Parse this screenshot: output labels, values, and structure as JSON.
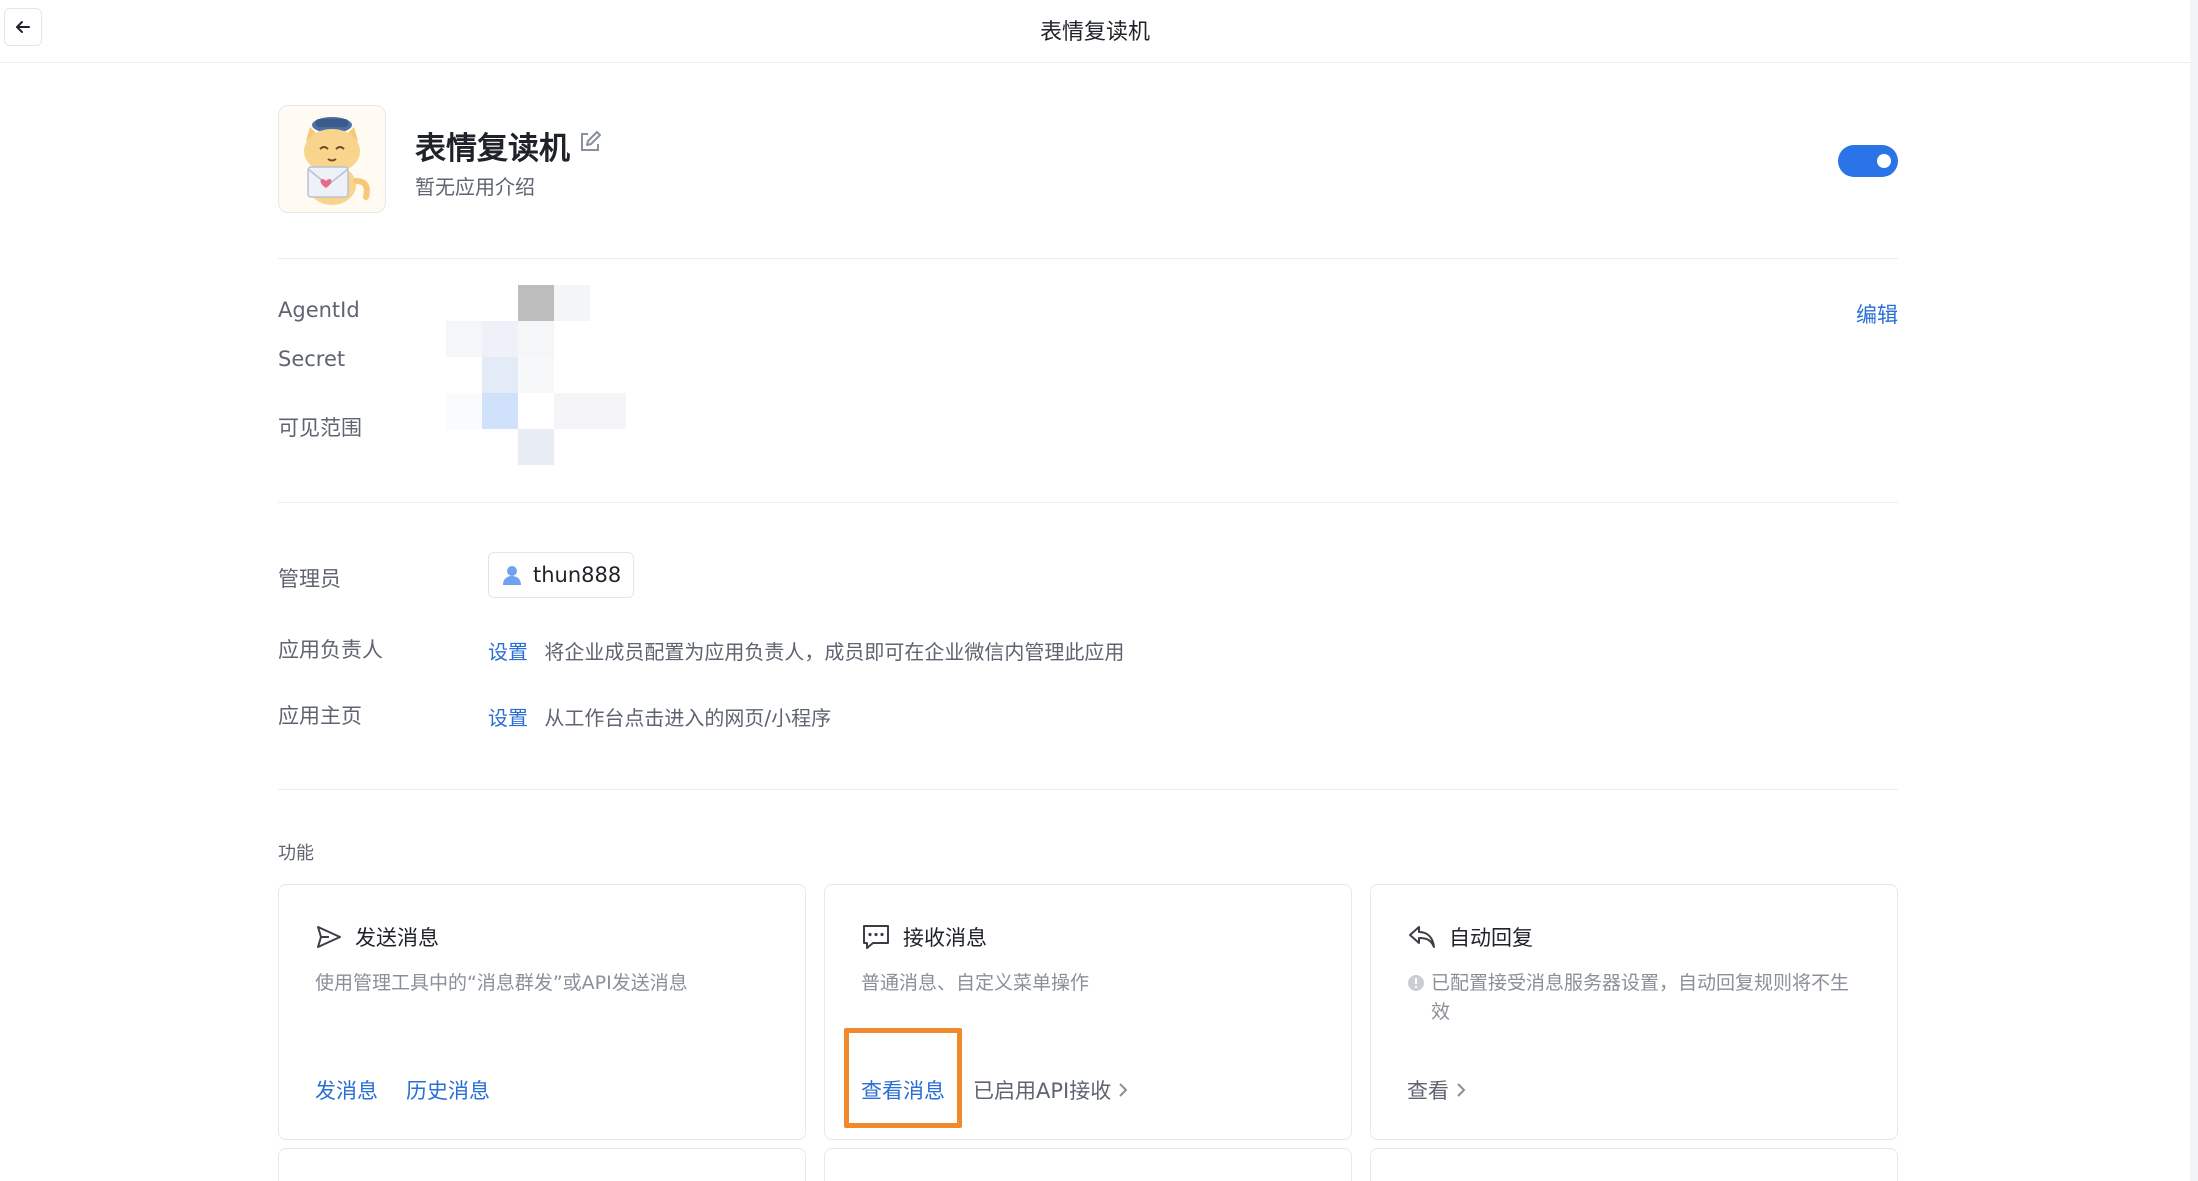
{
  "window": {
    "title": "表情复读机"
  },
  "app": {
    "name": "表情复读机",
    "description": "暂无应用介绍",
    "enabled": true,
    "accent": "#2a74e8"
  },
  "credentials": {
    "agentid_label": "AgentId",
    "secret_label": "Secret",
    "scope_label": "可见范围",
    "edit_label": "编辑"
  },
  "admin": {
    "admin_label": "管理员",
    "admin_user": "thun888",
    "owner_label": "应用负责人",
    "owner_action": "设置",
    "owner_hint": "将企业成员配置为应用负责人，成员即可在企业微信内管理此应用",
    "home_label": "应用主页",
    "home_action": "设置",
    "home_hint": "从工作台点击进入的网页/小程序"
  },
  "features": {
    "title": "功能",
    "cards": [
      {
        "title": "发送消息",
        "icon": "send-icon",
        "desc": "使用管理工具中的“消息群发”或API发送消息",
        "actions": [
          "发消息",
          "历史消息"
        ]
      },
      {
        "title": "接收消息",
        "icon": "chat-icon",
        "desc": "普通消息、自定义菜单操作",
        "actions": [
          "查看消息"
        ],
        "secondary": "已启用API接收"
      },
      {
        "title": "自动回复",
        "icon": "reply-icon",
        "desc": "已配置接受消息服务器设置，自动回复规则将不生效",
        "secondary": "查看"
      }
    ]
  }
}
